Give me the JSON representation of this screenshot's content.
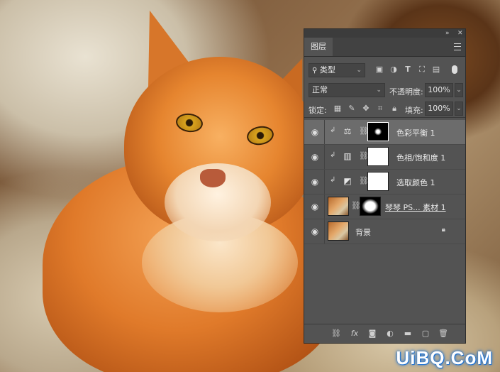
{
  "panel": {
    "title": "图层",
    "filter": {
      "kind": "类型",
      "kind_icon": "search-icon"
    },
    "filter_icons": [
      "image-icon",
      "circle-half-icon",
      "text-icon",
      "transform-icon",
      "smart-object-icon",
      "toggle-icon"
    ],
    "blend_mode": "正常",
    "opacity_label": "不透明度:",
    "opacity_value": "100%",
    "lock_label": "锁定:",
    "lock_icons": [
      "lock-transparent-icon",
      "lock-brush-icon",
      "lock-move-icon",
      "lock-artboard-icon",
      "lock-all-icon"
    ],
    "fill_label": "填充:",
    "fill_value": "100%",
    "layers": [
      {
        "name": "色彩平衡 1",
        "type": "adjustment",
        "adjust_icon": "color-balance-icon",
        "clipped": true,
        "selected": true,
        "mask": "black-with-spot"
      },
      {
        "name": "色相/饱和度 1",
        "type": "adjustment",
        "adjust_icon": "hue-saturation-icon",
        "clipped": true,
        "selected": false,
        "mask": "white"
      },
      {
        "name": "选取颜色 1",
        "type": "adjustment",
        "adjust_icon": "selective-color-icon",
        "clipped": true,
        "selected": false,
        "mask": "white"
      },
      {
        "name": "琴琴 PS... 素材 1",
        "type": "smart-object",
        "clipped": false,
        "selected": false,
        "mask": "white-blob"
      },
      {
        "name": "背景",
        "type": "background",
        "clipped": false,
        "selected": false,
        "locked": true
      }
    ],
    "bottom_icons": [
      "link-icon",
      "fx-icon",
      "add-mask-icon",
      "adjustment-layer-icon",
      "folder-icon",
      "new-layer-icon",
      "trash-icon"
    ],
    "fx_label": "fx"
  },
  "watermark": "UiBQ.CoM"
}
